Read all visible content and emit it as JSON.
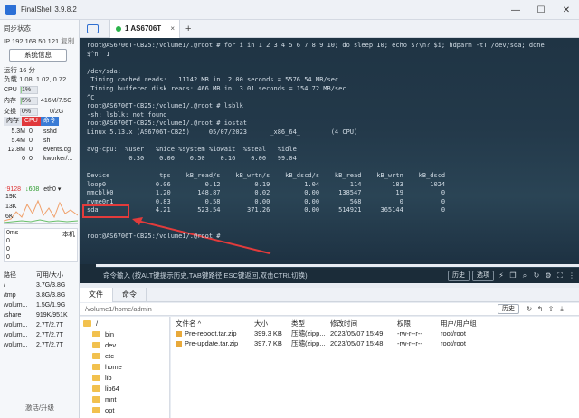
{
  "window": {
    "title": "FinalShell 3.9.8.2",
    "minimize": "—",
    "maximize": "☐",
    "close": "✕"
  },
  "sidebar": {
    "sync_status": "同步状态",
    "ip_label": "IP",
    "ip": "192.168.50.121",
    "copy": "复制",
    "sysinfo_button": "系统信息",
    "uptime": "运行 16 分",
    "load": "负载 1.08, 1.02, 0.72",
    "cpu": {
      "label": "CPU",
      "value": "1%",
      "fraction": 0.01
    },
    "mem": {
      "label": "内存",
      "percent": "5%",
      "value": "416M/7.5G",
      "fraction": 0.05
    },
    "swap": {
      "label": "交换",
      "percent": "0%",
      "value": "0/2G",
      "fraction": 0.0
    },
    "proc_tabs": [
      "内存",
      "CPU",
      "命令"
    ],
    "processes": [
      {
        "mem": "5.3M",
        "cpu": "0",
        "cmd": "sshd"
      },
      {
        "mem": "5.4M",
        "cpu": "0",
        "cmd": "sh"
      },
      {
        "mem": "12.8M",
        "cpu": "0",
        "cmd": "events.cg"
      },
      {
        "mem": "0",
        "cpu": "0",
        "cmd": "kworker/..."
      }
    ],
    "net": {
      "up": "↑9128",
      "down": "↓608",
      "iface": "eth0 ▾",
      "y_labels": [
        "19K",
        "13K",
        "6K"
      ]
    },
    "ping": {
      "left": "0ms",
      "right": "本机",
      "values": [
        "0",
        "0",
        "0"
      ]
    },
    "disk_head": {
      "path": "路径",
      "size": "可用/大小"
    },
    "disks": [
      {
        "path": "/",
        "size": "3.7G/3.8G"
      },
      {
        "path": "/tmp",
        "size": "3.8G/3.8G"
      },
      {
        "path": "/volum...",
        "size": "1.5G/1.9G"
      },
      {
        "path": "/share",
        "size": "919K/951K"
      },
      {
        "path": "/volum...",
        "size": "2.7T/2.7T"
      },
      {
        "path": "/volum...",
        "size": "2.7T/2.7T"
      },
      {
        "path": "/volum...",
        "size": "2.7T/2.7T"
      }
    ],
    "upgrade": "激活/升级"
  },
  "session_tab": {
    "label": "1 AS6706T",
    "close": "×",
    "add": "+"
  },
  "terminal": {
    "lines": [
      "root@AS6706T-CB25:/volume1/.@root # for i in 1 2 3 4 5 6 7 8 9 10; do sleep 10; echo $?\\n? $i; hdparm -tT /dev/sda; done",
      "$^n' 1",
      "",
      "/dev/sda:",
      " Timing cached reads:   11142 MB in  2.00 seconds = 5576.54 MB/sec",
      " Timing buffered disk reads: 466 MB in  3.01 seconds = 154.72 MB/sec",
      "^C",
      "root@AS6706T-CB25:/volume1/.@root # lsblk",
      "-sh: lsblk: not found",
      "root@AS6706T-CB25:/volume1/.@root # iostat",
      "Linux 5.13.x (AS6706T-CB25)     05/07/2023      _x86_64_        (4 CPU)",
      "",
      "avg-cpu:  %user   %nice %system %iowait  %steal   %idle",
      "           0.30    0.00    0.50    0.16    0.00   99.04",
      "",
      "Device             tps    kB_read/s    kB_wrtn/s    kB_dscd/s    kB_read    kB_wrtn    kB_dscd",
      "loop0             0.06         0.12         0.19         1.04        114        183       1024",
      "mmcblk0           1.20       148.87         0.02         0.00     138547         19          0",
      "nvme0n1           0.83         0.58         0.00         0.00        568          0          0",
      "sda               4.21       523.54       371.26         0.00     514921     365144          0",
      "",
      "",
      "root@AS6706T-CB25:/volume1/.@root #"
    ],
    "highlight_color": "#e23b3b"
  },
  "cmd_bar": {
    "placeholder": "命令输入 (按ALT键提示历史,TAB键路径,ESC键返回,双击CTRL切换)",
    "history": "历史",
    "options": "选项"
  },
  "file_manager": {
    "tabs": [
      "文件",
      "命令"
    ],
    "path": "/volume1/home/admin",
    "history": "历史",
    "tree": [
      "/",
      "bin",
      "dev",
      "etc",
      "home",
      "lib",
      "lib64",
      "mnt",
      "opt"
    ],
    "columns": [
      "文件名 ^",
      "大小",
      "类型",
      "修改时间",
      "权限",
      "用户/用户组"
    ],
    "files": [
      {
        "name": "Pre-reboot.tar.zip",
        "size": "399.3 KB",
        "type": "压缩(zipp...",
        "mtime": "2023/05/07 15:49",
        "perm": "-rw-r--r--",
        "owner": "root/root"
      },
      {
        "name": "Pre-update.tar.zip",
        "size": "397.7 KB",
        "type": "压缩(zipp...",
        "mtime": "2023/05/07 15:48",
        "perm": "-rw-r--r--",
        "owner": "root/root"
      }
    ]
  }
}
